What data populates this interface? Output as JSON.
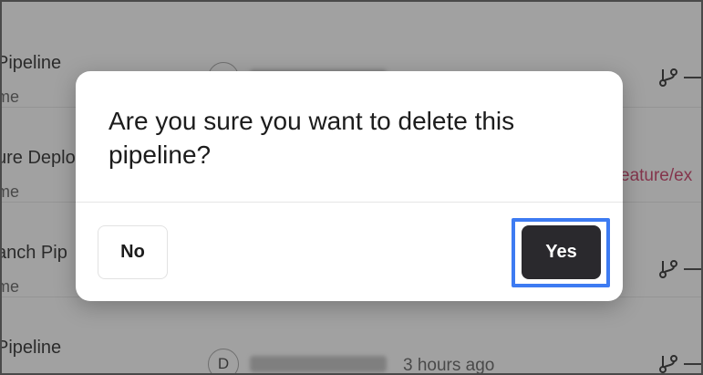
{
  "background": {
    "rows": [
      {
        "title": "Pipeline",
        "subtitle": "me"
      },
      {
        "title": "ure Deplo",
        "subtitle": "me",
        "branch": "eature/ex"
      },
      {
        "title": "anch Pip",
        "subtitle": "me"
      },
      {
        "title": "Pipeline",
        "author_initial": "D",
        "time": "3 hours ago"
      }
    ]
  },
  "dialog": {
    "title": "Are you sure you want to delete this pipeline?",
    "no_label": "No",
    "yes_label": "Yes"
  },
  "colors": {
    "focus_ring": "#3d7bf2",
    "primary_button": "#2a292d",
    "branch_text": "#c0305a"
  }
}
